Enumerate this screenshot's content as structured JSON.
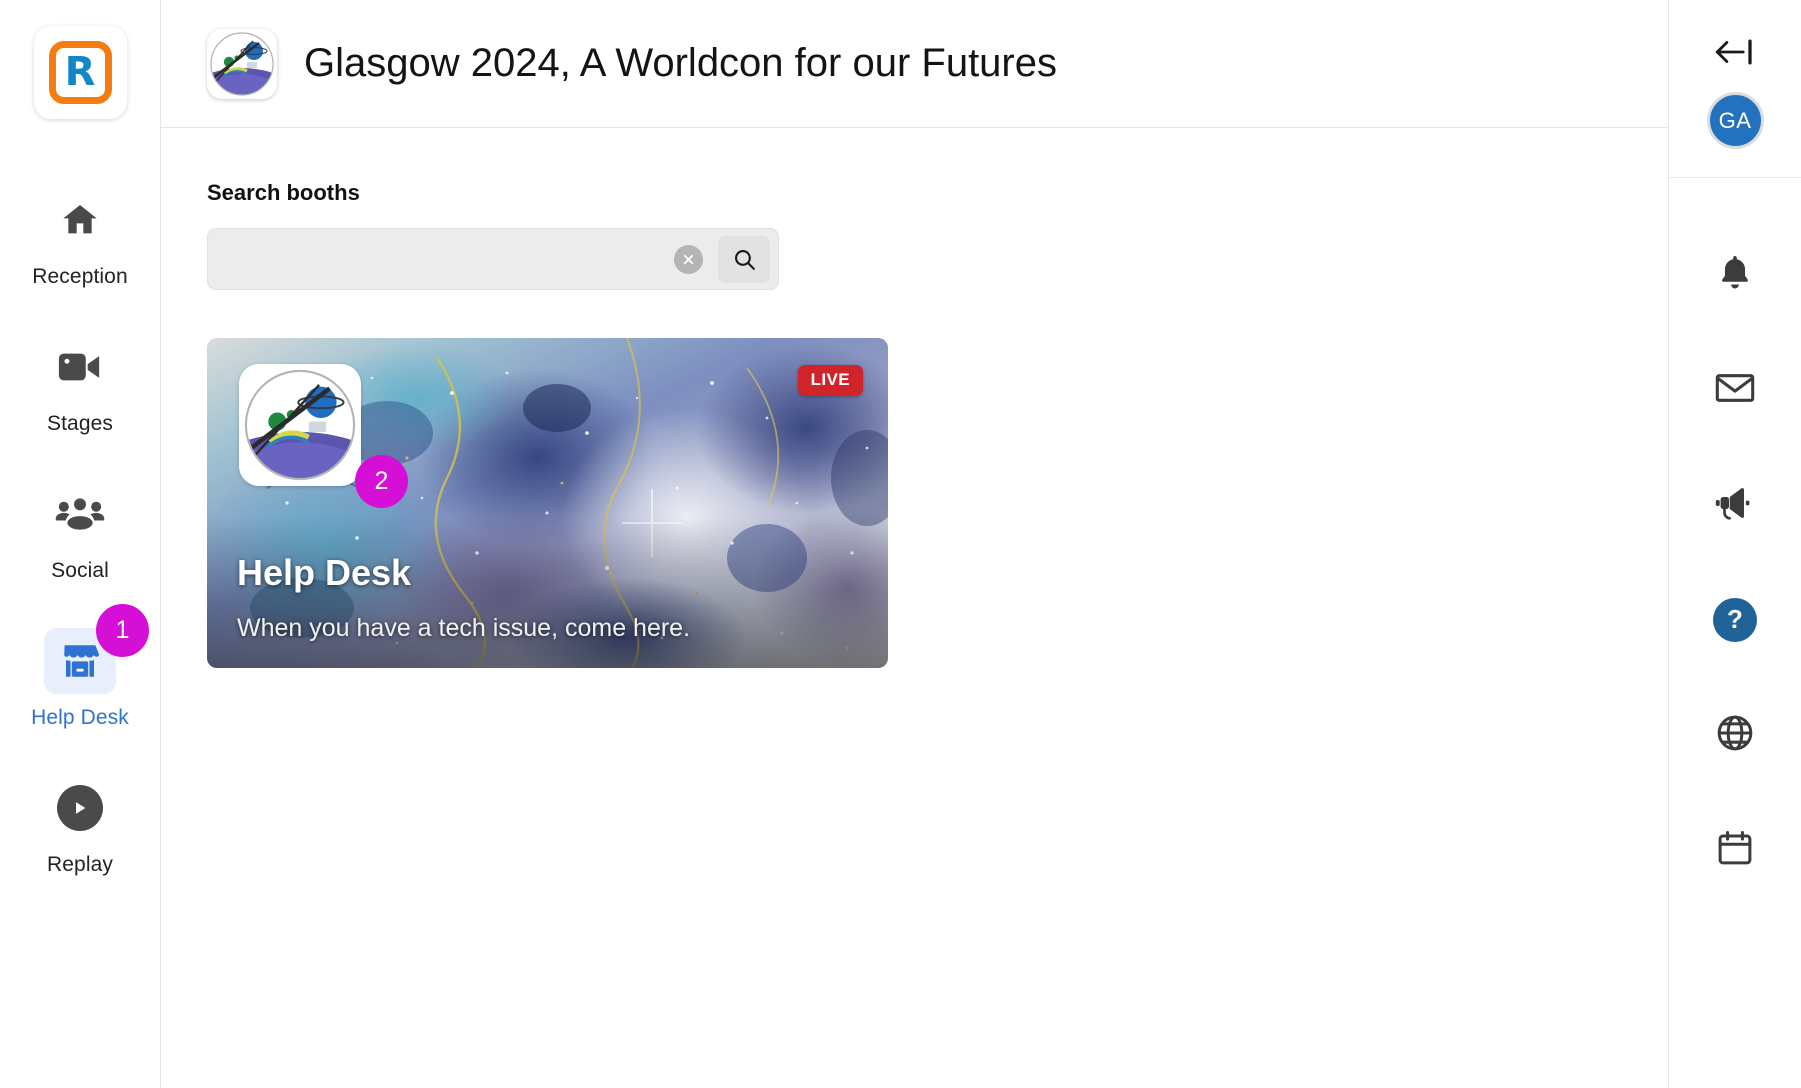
{
  "brand": {
    "logo_letter": "R",
    "logo_name": "rumi-logo",
    "border_color": "#f57c10",
    "letter_color": "#1287c6"
  },
  "sidebar": {
    "items": [
      {
        "label": "Reception",
        "icon": "home-icon",
        "active": false,
        "badge": null
      },
      {
        "label": "Stages",
        "icon": "video-camera-icon",
        "active": false,
        "badge": null
      },
      {
        "label": "Social",
        "icon": "people-group-icon",
        "active": false,
        "badge": null
      },
      {
        "label": "Help Desk",
        "icon": "storefront-icon",
        "active": true,
        "badge": "1"
      },
      {
        "label": "Replay",
        "icon": "play-circle-icon",
        "active": false,
        "badge": null
      }
    ],
    "active_color": "#2f73d0",
    "badge_color": "#d50fd5"
  },
  "header": {
    "title": "Glasgow 2024, A Worldcon for our Futures",
    "logo_name": "event-logo"
  },
  "search": {
    "label": "Search booths",
    "value": "",
    "placeholder": "",
    "clear_icon": "close-circle-icon",
    "submit_icon": "search-icon"
  },
  "booths": [
    {
      "name": "Help Desk",
      "description": "When you have a tech issue, come here.",
      "live_label": "LIVE",
      "badge": "2",
      "live_color": "#d1232a",
      "badge_color": "#d50fd5"
    }
  ],
  "right_rail": {
    "collapse_icon": "collapse-panel-icon",
    "avatar_initials": "GA",
    "avatar_color": "#2471c0",
    "items": [
      {
        "icon": "bell-icon",
        "name": "notifications-button"
      },
      {
        "icon": "envelope-icon",
        "name": "messages-button"
      },
      {
        "icon": "megaphone-icon",
        "name": "announcements-button"
      },
      {
        "icon": "question-mark-icon",
        "name": "help-button"
      },
      {
        "icon": "globe-icon",
        "name": "language-button"
      },
      {
        "icon": "calendar-icon",
        "name": "schedule-button"
      }
    ],
    "help_color": "#1f6399"
  }
}
